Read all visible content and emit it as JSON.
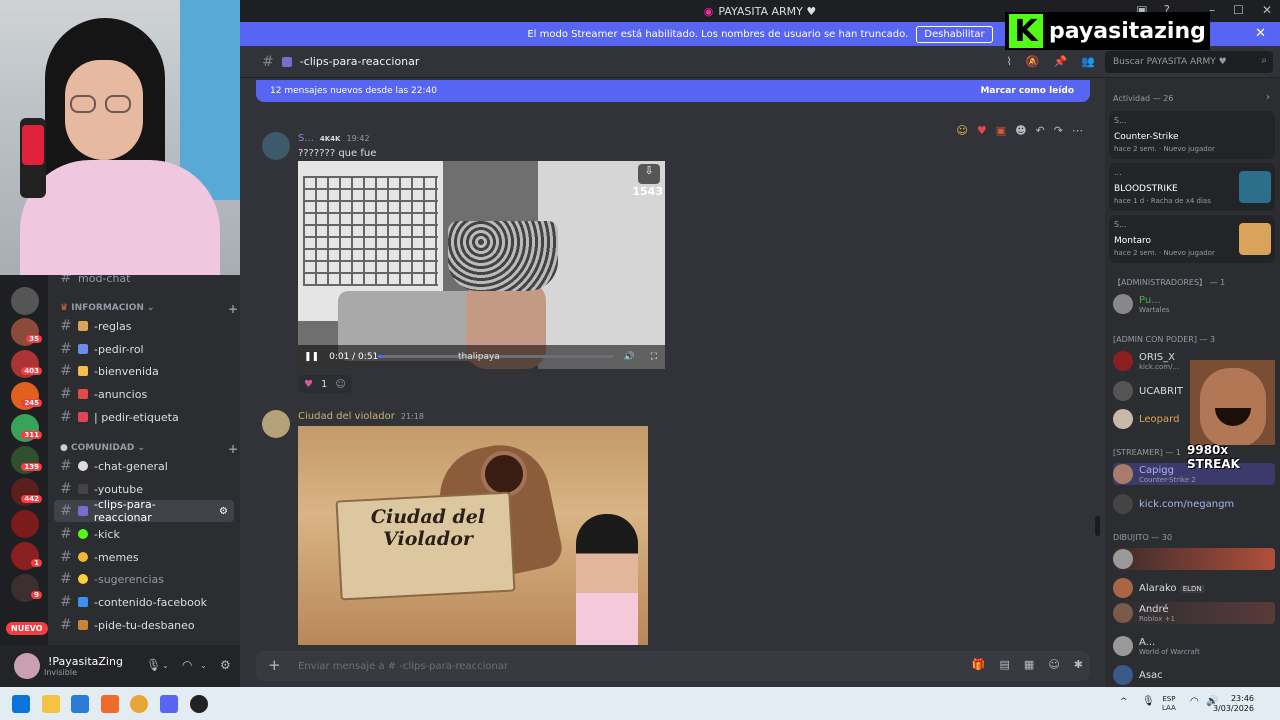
{
  "window": {
    "title": "PAYASITA ARMY ♥"
  },
  "banner": {
    "text": "El modo Streamer está habilitado. Los nombres de usuario se han truncado.",
    "button": "Deshabilitar"
  },
  "overlay": {
    "logo_text": "payasitazing",
    "streak_text": "9980x STREAK"
  },
  "server_badges": [
    "35",
    "403",
    "245",
    "311",
    "139",
    "442",
    "1",
    "9"
  ],
  "server_new": "NUEVO",
  "sidebar": {
    "top_channel": "mod-chat",
    "categories": [
      "INFORMACION",
      "COMUNIDAD"
    ],
    "channels_info": [
      "-reglas",
      "-pedir-rol",
      "-bienvenida",
      "-anuncios",
      "| pedir-etiqueta"
    ],
    "channels_comunidad": [
      "-chat-general",
      "-youtube",
      "-clips-para-reaccionar",
      "-kick",
      "-memes",
      "-sugerencias",
      "-contenido-facebook",
      "-pide-tu-desbaneo"
    ]
  },
  "user_panel": {
    "name": "!PayasitaZing",
    "status": "Invisible"
  },
  "channel_header": {
    "name": "-clips-para-reaccionar",
    "search_placeholder": "Buscar PAYASITA ARMY ♥"
  },
  "newbar": {
    "text": "12 mensajes nuevos desde las 22:40",
    "action": "Marcar como leído"
  },
  "messages": [
    {
      "author": "S...",
      "tag": "4K4K",
      "time": "19:42",
      "text": "??????? que fue",
      "video": {
        "time": "0:01 / 0:51",
        "progress": 0.02,
        "watermark": "1543",
        "watermark2": "thalipaya"
      },
      "reaction_count": "1"
    },
    {
      "author": "Ciudad del violador",
      "time": "21:18",
      "image_text": "Ciudad del Violador"
    }
  ],
  "composer": {
    "placeholder": "Enviar mensaje a # -clips-para-reaccionar"
  },
  "members": {
    "activity_header": "Actividad — 26",
    "activity": [
      {
        "user": "S...",
        "game": "Counter-Strike",
        "detail": "hace 2 sem.",
        "extra": "Nuevo jugador"
      },
      {
        "user": "...",
        "game": "BLOODSTRIKE",
        "detail": "hace 1 d",
        "extra": "Racha de x4 días"
      },
      {
        "user": "S...",
        "game": "Montaro",
        "detail": "hace 2 sem.",
        "extra": "Nuevo jugador"
      }
    ],
    "sections": [
      {
        "label": "【ADMINISTRADORES】 — 1",
        "rows": [
          {
            "name": "Pu...",
            "sub": "Wartales"
          }
        ]
      },
      {
        "label": "[ADMIN CON PODER] — 3",
        "rows": [
          {
            "name": "ORIS_X",
            "sub": "kick.com/..."
          },
          {
            "name": "UCABRIT",
            "sub": ""
          },
          {
            "name": "Leopard",
            "sub": ""
          }
        ]
      },
      {
        "label": "[STREAMER] — 1",
        "rows": [
          {
            "name": "Capigg",
            "sub": "Counter-Strike 2"
          },
          {
            "name": "kick.com/negangm",
            "sub": ""
          }
        ]
      },
      {
        "label": "DIBUJITO — 30",
        "rows": [
          {
            "name": "",
            "sub": ""
          },
          {
            "name": "Alarako",
            "sub": "ELDN"
          },
          {
            "name": "André",
            "sub": "Roblox +1"
          },
          {
            "name": "A...",
            "sub": "World of Warcraft"
          },
          {
            "name": "Asac",
            "sub": ""
          }
        ]
      }
    ]
  },
  "taskbar": {
    "lang1": "ESP",
    "lang2": "LAA",
    "time": "23:46",
    "date": "3/03/2026"
  }
}
